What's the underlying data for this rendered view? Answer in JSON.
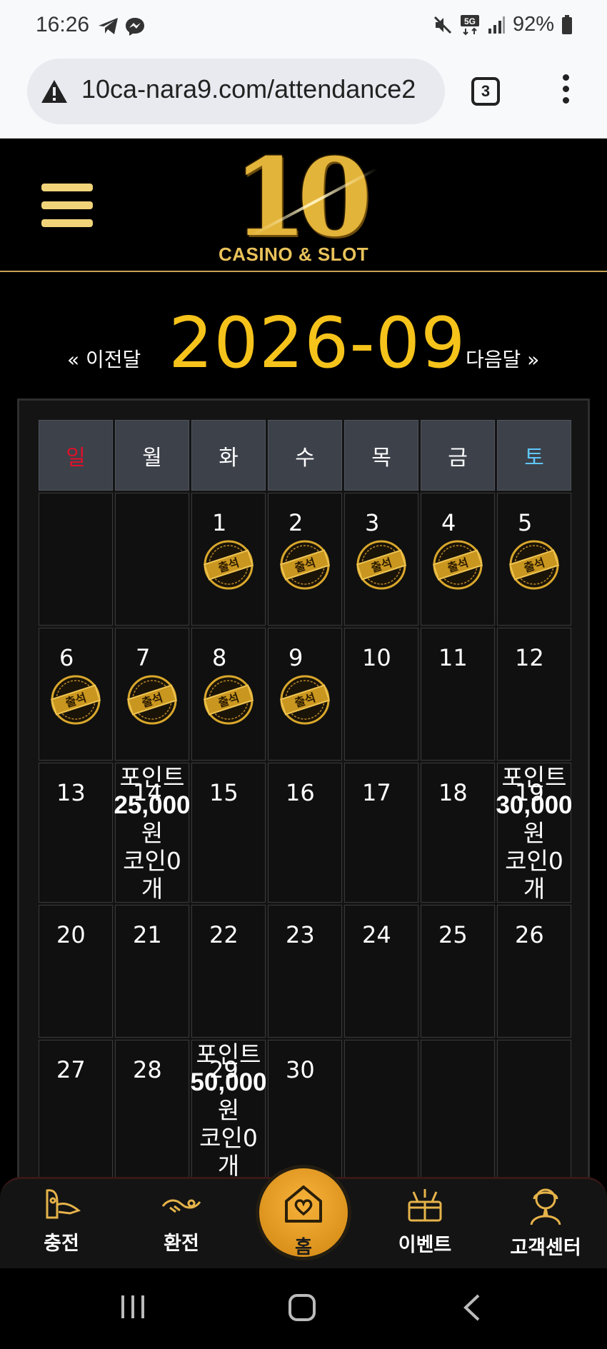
{
  "status_bar": {
    "time": "16:26",
    "battery": "92%"
  },
  "browser": {
    "url": "10ca-nara9.com/attendance2",
    "tab_count": "3"
  },
  "site": {
    "logo_number": "10",
    "logo_subtitle": "CASINO & SLOT"
  },
  "calendar": {
    "prev_label": "« 이전달",
    "month_title": "2026-09",
    "next_label": "다음달 »",
    "weekdays": [
      "일",
      "월",
      "화",
      "수",
      "목",
      "금",
      "토"
    ],
    "stamp_text": "출석",
    "weeks": [
      [
        {
          "day": ""
        },
        {
          "day": ""
        },
        {
          "day": "1",
          "stamp": true
        },
        {
          "day": "2",
          "stamp": true
        },
        {
          "day": "3",
          "stamp": true
        },
        {
          "day": "4",
          "stamp": true
        },
        {
          "day": "5",
          "stamp": true
        }
      ],
      [
        {
          "day": "6",
          "stamp": true
        },
        {
          "day": "7",
          "stamp": true
        },
        {
          "day": "8",
          "stamp": true
        },
        {
          "day": "9",
          "stamp": true
        },
        {
          "day": "10"
        },
        {
          "day": "11"
        },
        {
          "day": "12"
        }
      ],
      [
        {
          "day": "13"
        },
        {
          "day": "14",
          "reward": [
            "포인트",
            "25,000",
            "원",
            "코인0",
            "개"
          ]
        },
        {
          "day": "15"
        },
        {
          "day": "16"
        },
        {
          "day": "17"
        },
        {
          "day": "18"
        },
        {
          "day": "19",
          "reward": [
            "포인트",
            "30,000",
            "원",
            "코인0",
            "개"
          ]
        }
      ],
      [
        {
          "day": "20"
        },
        {
          "day": "21"
        },
        {
          "day": "22"
        },
        {
          "day": "23"
        },
        {
          "day": "24"
        },
        {
          "day": "25"
        },
        {
          "day": "26"
        }
      ],
      [
        {
          "day": "27"
        },
        {
          "day": "28"
        },
        {
          "day": "29",
          "reward": [
            "포인트",
            "50,000",
            "원",
            "코인0",
            "개"
          ]
        },
        {
          "day": "30"
        },
        {
          "day": ""
        },
        {
          "day": ""
        },
        {
          "day": ""
        }
      ]
    ]
  },
  "bottom_nav": {
    "deposit": "충전",
    "withdraw": "환전",
    "home": "홈",
    "event": "이벤트",
    "support": "고객센터"
  },
  "colors": {
    "gold": "#f6c31b",
    "sunday": "#e0102a",
    "saturday": "#5fc6ff",
    "home_button": "#e89b20"
  }
}
